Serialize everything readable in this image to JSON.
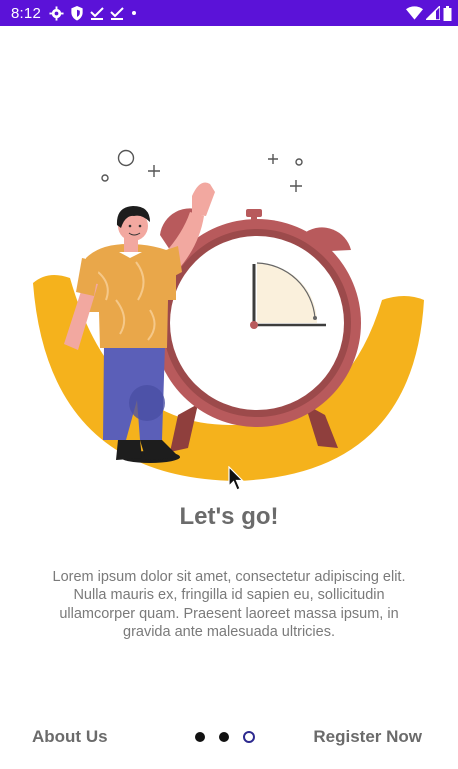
{
  "status_bar": {
    "time": "8:12",
    "left_icons": [
      "gear-icon",
      "shield-icon",
      "download-check-icon",
      "download-check-icon",
      "dot-icon"
    ],
    "right_icons": [
      "wifi-icon",
      "signal-icon",
      "battery-icon"
    ],
    "background": "#5b12d8"
  },
  "onboarding": {
    "title": "Let's go!",
    "description": "Lorem ipsum dolor sit amet, consectetur adipiscing elit. Nulla mauris ex, fringilla id sapien eu, sollicitudin ullamcorper quam. Praesent laoreet massa ipsum, in gravida ante malesuada ultricies.",
    "illustration": "person-waving-beside-alarm-clock",
    "colors": {
      "accent_yellow": "#f5b21c",
      "clock_red": "#b85a5c",
      "shirt": "#e9a74a",
      "pants": "#5b5fb8"
    }
  },
  "navigation": {
    "left_label": "About Us",
    "right_label": "Register Now",
    "page_count": 3,
    "active_page": 3
  }
}
